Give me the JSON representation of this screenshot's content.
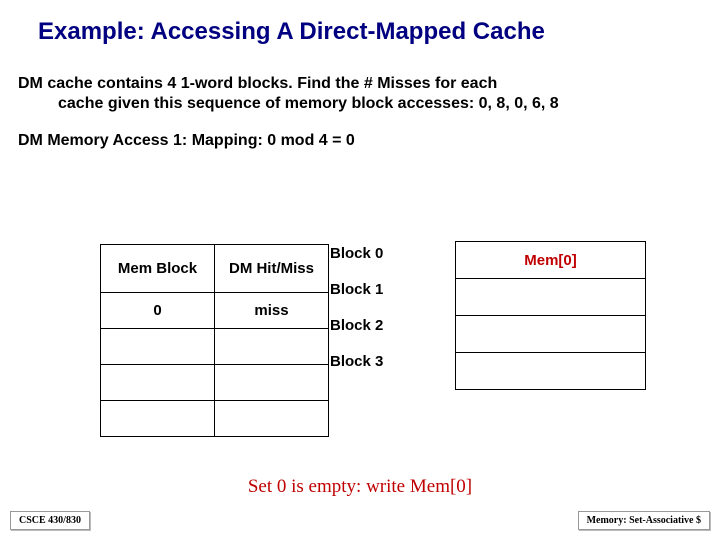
{
  "title": "Example: Accessing A Direct-Mapped Cache",
  "subtitle_line1": "DM cache contains 4 1-word blocks. Find the # Misses for each",
  "subtitle_line2": "cache given this sequence of memory block accesses: 0, 8, 0, 6, 8",
  "access_line": "DM Memory Access 1:  Mapping: 0 mod 4 = 0",
  "left_table": {
    "headers": [
      "Mem Block",
      "DM Hit/Miss"
    ],
    "rows": [
      [
        "0",
        "miss"
      ],
      [
        "",
        ""
      ],
      [
        "",
        ""
      ],
      [
        "",
        ""
      ]
    ]
  },
  "block_labels": [
    "Block 0",
    "Block 1",
    "Block 2",
    "Block 3"
  ],
  "right_table": {
    "rows": [
      "Mem[0]",
      "",
      "",
      ""
    ]
  },
  "caption": "Set 0 is empty: write Mem[0]",
  "footer_left": "CSCE 430/830",
  "footer_right": "Memory: Set-Associative $",
  "chart_data": {
    "type": "table",
    "title": "Direct-Mapped Cache Access 1",
    "mem_block_accessed": 0,
    "mapping": "0 mod 4 = 0",
    "hit_miss": "miss",
    "cache_state": {
      "Block 0": "Mem[0]",
      "Block 1": "",
      "Block 2": "",
      "Block 3": ""
    },
    "access_sequence": [
      0,
      8,
      0,
      6,
      8
    ],
    "num_blocks": 4
  }
}
